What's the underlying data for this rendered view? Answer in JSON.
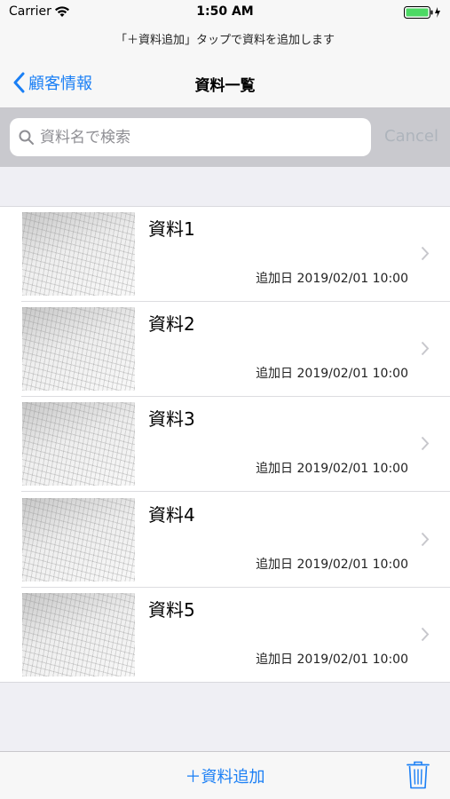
{
  "status_bar": {
    "carrier": "Carrier",
    "time": "1:50 AM"
  },
  "prompt": "「＋資料追加」タップで資料を追加します",
  "nav": {
    "back_label": "顧客情報",
    "title": "資料一覧"
  },
  "search": {
    "placeholder": "資料名で検索",
    "value": "",
    "cancel_label": "Cancel"
  },
  "items": [
    {
      "title": "資料1",
      "date": "追加日 2019/02/01 10:00"
    },
    {
      "title": "資料2",
      "date": "追加日 2019/02/01 10:00"
    },
    {
      "title": "資料3",
      "date": "追加日 2019/02/01 10:00"
    },
    {
      "title": "資料4",
      "date": "追加日 2019/02/01 10:00"
    },
    {
      "title": "資料5",
      "date": "追加日 2019/02/01 10:00"
    }
  ],
  "toolbar": {
    "add_label": "＋資料追加"
  },
  "colors": {
    "accent": "#1a7ff5",
    "battery": "#4cd964"
  }
}
